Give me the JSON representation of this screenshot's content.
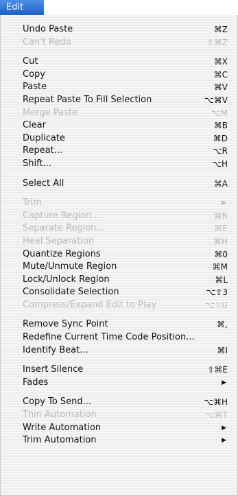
{
  "menubar": {
    "title": "Edit"
  },
  "colors": {
    "accent": "#2a6fd6",
    "text": "#111111",
    "disabled": "#b9b9b9"
  },
  "items": [
    {
      "label": "Undo Paste",
      "shortcut": "⌘Z",
      "disabled": false
    },
    {
      "label": "Can't Redo",
      "shortcut": "⇧⌘Z",
      "disabled": true
    },
    {
      "label": "Cut",
      "shortcut": "⌘X",
      "disabled": false
    },
    {
      "label": "Copy",
      "shortcut": "⌘C",
      "disabled": false
    },
    {
      "label": "Paste",
      "shortcut": "⌘V",
      "disabled": false
    },
    {
      "label": "Repeat Paste To Fill Selection",
      "shortcut": "⌥⌘V",
      "disabled": false
    },
    {
      "label": "Merge Paste",
      "shortcut": "⌥M",
      "disabled": true
    },
    {
      "label": "Clear",
      "shortcut": "⌘B",
      "disabled": false
    },
    {
      "label": "Duplicate",
      "shortcut": "⌘D",
      "disabled": false
    },
    {
      "label": "Repeat...",
      "shortcut": "⌥R",
      "disabled": false
    },
    {
      "label": "Shift...",
      "shortcut": "⌥H",
      "disabled": false
    },
    {
      "label": "Select All",
      "shortcut": "⌘A",
      "disabled": false
    },
    {
      "label": "Trim",
      "shortcut": "",
      "disabled": true
    },
    {
      "label": "Capture Region...",
      "shortcut": "⌘R",
      "disabled": true
    },
    {
      "label": "Separate Region...",
      "shortcut": "⌘E",
      "disabled": true
    },
    {
      "label": "Heal Separation",
      "shortcut": "⌘H",
      "disabled": true
    },
    {
      "label": "Quantize Regions",
      "shortcut": "⌘0",
      "disabled": false
    },
    {
      "label": "Mute/Unmute Region",
      "shortcut": "⌘M",
      "disabled": false
    },
    {
      "label": "Lock/Unlock Region",
      "shortcut": "⌘L",
      "disabled": false
    },
    {
      "label": "Consolidate Selection",
      "shortcut": "⌥⇧3",
      "disabled": false
    },
    {
      "label": "Compress/Expand Edit to Play",
      "shortcut": "⌥⇧U",
      "disabled": true
    },
    {
      "label": "Remove Sync Point",
      "shortcut": "⌘,",
      "disabled": false
    },
    {
      "label": "Redefine Current Time Code Position...",
      "shortcut": "",
      "disabled": false
    },
    {
      "label": "Identify Beat...",
      "shortcut": "⌘I",
      "disabled": false
    },
    {
      "label": "Insert Silence",
      "shortcut": "⇧⌘E",
      "disabled": false
    },
    {
      "label": "Fades",
      "shortcut": "",
      "disabled": false
    },
    {
      "label": "Copy To Send...",
      "shortcut": "⌥⌘H",
      "disabled": false
    },
    {
      "label": "Thin Automation",
      "shortcut": "⌥⌘T",
      "disabled": true
    },
    {
      "label": "Write Automation",
      "shortcut": "",
      "disabled": false
    },
    {
      "label": "Trim Automation",
      "shortcut": "",
      "disabled": false
    }
  ],
  "submenu_arrow": "▶"
}
